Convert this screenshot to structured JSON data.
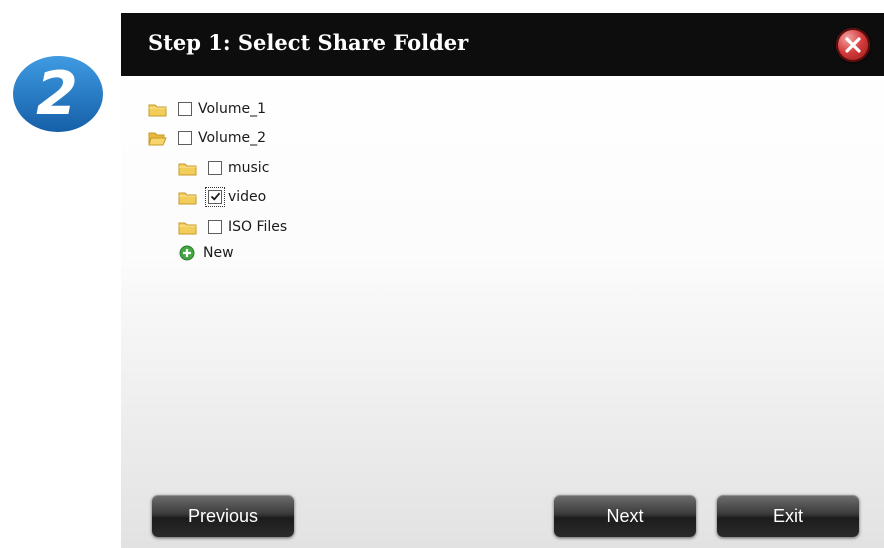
{
  "step_badge": {
    "number": "2",
    "color": "#1d79c6"
  },
  "dialog": {
    "title": "Step 1: Select Share Folder",
    "close_icon": "close-icon"
  },
  "tree": {
    "volumes": [
      {
        "label": "Volume_1",
        "checked": false,
        "expanded": false
      },
      {
        "label": "Volume_2",
        "checked": false,
        "expanded": true,
        "children": [
          {
            "label": "music",
            "checked": false
          },
          {
            "label": "video",
            "checked": true
          },
          {
            "label": "ISO Files",
            "checked": false
          }
        ]
      }
    ],
    "new_label": "New"
  },
  "buttons": {
    "previous": "Previous",
    "next": "Next",
    "exit": "Exit"
  },
  "colors": {
    "titlebar": "#0d0d0d",
    "close_button": "#d33b3b",
    "folder": "#f0c64a",
    "new_icon": "#4caf50"
  }
}
